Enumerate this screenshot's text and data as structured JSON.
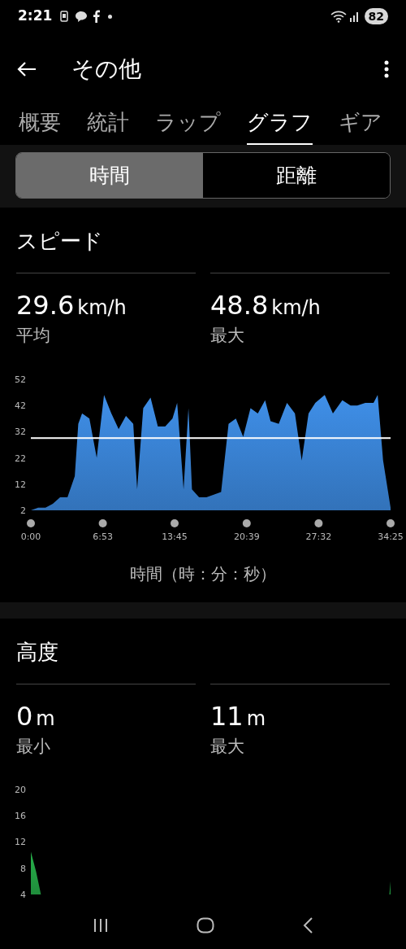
{
  "status_bar": {
    "time": "2:21",
    "battery": "82"
  },
  "app_bar": {
    "title": "その他"
  },
  "tabs": [
    {
      "label": "概要",
      "selected": false
    },
    {
      "label": "統計",
      "selected": false
    },
    {
      "label": "ラップ",
      "selected": false
    },
    {
      "label": "グラフ",
      "selected": true
    },
    {
      "label": "ギア",
      "selected": false
    }
  ],
  "segments": [
    {
      "label": "時間",
      "selected": true
    },
    {
      "label": "距離",
      "selected": false
    }
  ],
  "sections": [
    {
      "title": "スピード",
      "stats": [
        {
          "value": "29.6",
          "unit": "km/h",
          "label": "平均"
        },
        {
          "value": "48.8",
          "unit": "km/h",
          "label": "最大"
        }
      ],
      "chart_data": {
        "type": "area",
        "xlabel": "時間（時：分：秒）",
        "xlim": [
          0,
          2065
        ],
        "ylim": [
          2,
          52
        ],
        "x": [
          0,
          42,
          84,
          126,
          168,
          210,
          252,
          272,
          294,
          336,
          378,
          420,
          462,
          504,
          546,
          588,
          610,
          645,
          687,
          729,
          771,
          813,
          840,
          877,
          905,
          925,
          966,
          1008,
          1050,
          1092,
          1135,
          1177,
          1219,
          1261,
          1303,
          1345,
          1376,
          1423,
          1470,
          1516,
          1555,
          1594,
          1633,
          1687,
          1734,
          1788,
          1835,
          1874,
          1920,
          1967,
          1991,
          2022,
          2065
        ],
        "series": [
          {
            "color": "#3f8fe8",
            "values": [
              2,
              3,
              3,
              4.5,
              7,
              7,
              15,
              35,
              39,
              37,
              22,
              46,
              39,
              33,
              38,
              35,
              10,
              41,
              45,
              34,
              34,
              37,
              43,
              10,
              41,
              10,
              7,
              7,
              8,
              9,
              35,
              37,
              30,
              41,
              39,
              44,
              36,
              35,
              43,
              39,
              21,
              39,
              43,
              46,
              39,
              44,
              42,
              42,
              43,
              43,
              46,
              21,
              3
            ]
          }
        ],
        "xticks": [
          {
            "value": 0,
            "label": "0:00"
          },
          {
            "value": 413,
            "label": "6:53"
          },
          {
            "value": 825,
            "label": "13:45"
          },
          {
            "value": 1239,
            "label": "20:39"
          },
          {
            "value": 1652,
            "label": "27:32"
          },
          {
            "value": 2065,
            "label": "34:25"
          }
        ],
        "yticks": [
          2,
          12,
          22,
          32,
          42,
          52
        ],
        "ref_lines": [
          {
            "axis": "y",
            "value": 29.6
          }
        ]
      }
    },
    {
      "title": "高度",
      "stats": [
        {
          "value": "0",
          "unit": "m",
          "label": "最小"
        },
        {
          "value": "11",
          "unit": "m",
          "label": "最大"
        }
      ],
      "chart_data": {
        "type": "area",
        "xlim": [
          0,
          2065
        ],
        "ylim": [
          4,
          20
        ],
        "x": [
          0,
          30,
          58,
          2058,
          2065
        ],
        "series": [
          {
            "color": "#27b04a",
            "values": [
              10.5,
              7.5,
              4,
              4,
              6
            ]
          }
        ],
        "yticks": [
          4,
          8,
          12,
          16,
          20
        ]
      }
    }
  ]
}
